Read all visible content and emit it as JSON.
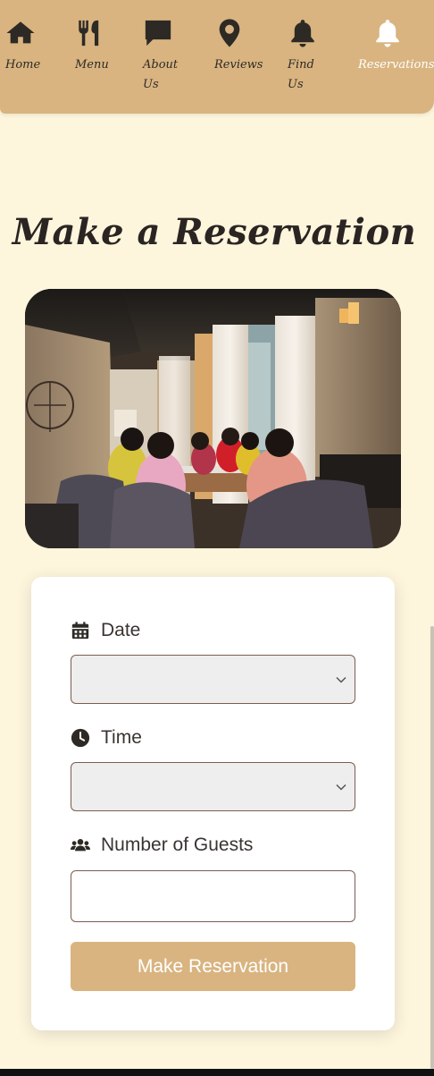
{
  "nav": {
    "items": [
      {
        "label": "Home",
        "icon": "home-icon"
      },
      {
        "label": "Menu",
        "icon": "utensils-icon"
      },
      {
        "label": "About Us",
        "icon": "comment-icon"
      },
      {
        "label": "Reviews",
        "icon": "map-pin-icon"
      },
      {
        "label": "Find Us",
        "icon": "bell-icon"
      },
      {
        "label": "Reservations",
        "icon": "bell-icon",
        "active": true
      }
    ]
  },
  "page": {
    "title": "Make a Reservation"
  },
  "form": {
    "date_label": "Date",
    "date_value": "",
    "time_label": "Time",
    "time_value": "",
    "guests_label": "Number of Guests",
    "guests_value": "",
    "submit_label": "Make Reservation"
  },
  "colors": {
    "background": "#fdf5dc",
    "accent": "#d9b480",
    "card": "#ffffff",
    "text": "#3a2f2c"
  }
}
